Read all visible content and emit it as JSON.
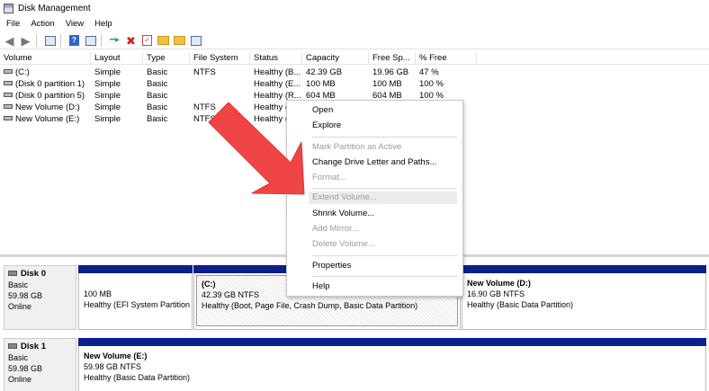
{
  "window": {
    "title": "Disk Management"
  },
  "menu": [
    "File",
    "Action",
    "View",
    "Help"
  ],
  "toolbar": {
    "icons": [
      "back-icon",
      "forward-icon",
      "properties-icon",
      "help-icon",
      "console-icon",
      "connect-icon",
      "delete-icon",
      "check-icon",
      "import-icon",
      "export-icon",
      "view-icon"
    ]
  },
  "volumes": {
    "headers": [
      "Volume",
      "Layout",
      "Type",
      "File System",
      "Status",
      "Capacity",
      "Free Sp...",
      "% Free"
    ],
    "rows": [
      [
        "(C:)",
        "Simple",
        "Basic",
        "NTFS",
        "Healthy (B...",
        "42.39 GB",
        "19.96 GB",
        "47 %"
      ],
      [
        "(Disk 0 partition 1)",
        "Simple",
        "Basic",
        "",
        "Healthy (E...",
        "100 MB",
        "100 MB",
        "100 %"
      ],
      [
        "(Disk 0 partition 5)",
        "Simple",
        "Basic",
        "",
        "Healthy (R...",
        "604 MB",
        "604 MB",
        "100 %"
      ],
      [
        "New Volume (D:)",
        "Simple",
        "Basic",
        "NTFS",
        "Healthy (...",
        "",
        "",
        ""
      ],
      [
        "New Volume (E:)",
        "Simple",
        "Basic",
        "NTFS",
        "Healthy (...",
        "",
        "",
        ""
      ]
    ]
  },
  "disks": [
    {
      "name": "Disk 0",
      "type": "Basic",
      "size": "59.98 GB",
      "state": "Online",
      "partitions": [
        {
          "name": "",
          "size": "100 MB",
          "status": "Healthy (EFI System Partition"
        },
        {
          "name": "(C:)",
          "size": "42.39 GB NTFS",
          "status": "Healthy (Boot, Page File, Crash Dump, Basic Data Partition)"
        },
        {
          "name": "New Volume  (D:)",
          "size": "16.90 GB NTFS",
          "status": "Healthy (Basic Data Partition)"
        }
      ]
    },
    {
      "name": "Disk 1",
      "type": "Basic",
      "size": "59.98 GB",
      "state": "Online",
      "partitions": [
        {
          "name": "New Volume  (E:)",
          "size": "59.98 GB NTFS",
          "status": "Healthy (Basic Data Partition)"
        }
      ]
    }
  ],
  "context_menu": {
    "items": [
      {
        "label": "Open",
        "enabled": true
      },
      {
        "label": "Explore",
        "enabled": true
      },
      {
        "label": "Mark Partition as Active",
        "enabled": false
      },
      {
        "label": "Change Drive Letter and Paths...",
        "enabled": true
      },
      {
        "label": "Format...",
        "enabled": false
      },
      {
        "label": "Extend Volume...",
        "enabled": false
      },
      {
        "label": "Shrink Volume...",
        "enabled": true
      },
      {
        "label": "Add Mirror...",
        "enabled": false
      },
      {
        "label": "Delete Volume...",
        "enabled": false
      },
      {
        "label": "Properties",
        "enabled": true
      },
      {
        "label": "Help",
        "enabled": true
      }
    ]
  },
  "colors": {
    "partition_bar": "#0d1f8a",
    "arrow": "#f04545"
  }
}
